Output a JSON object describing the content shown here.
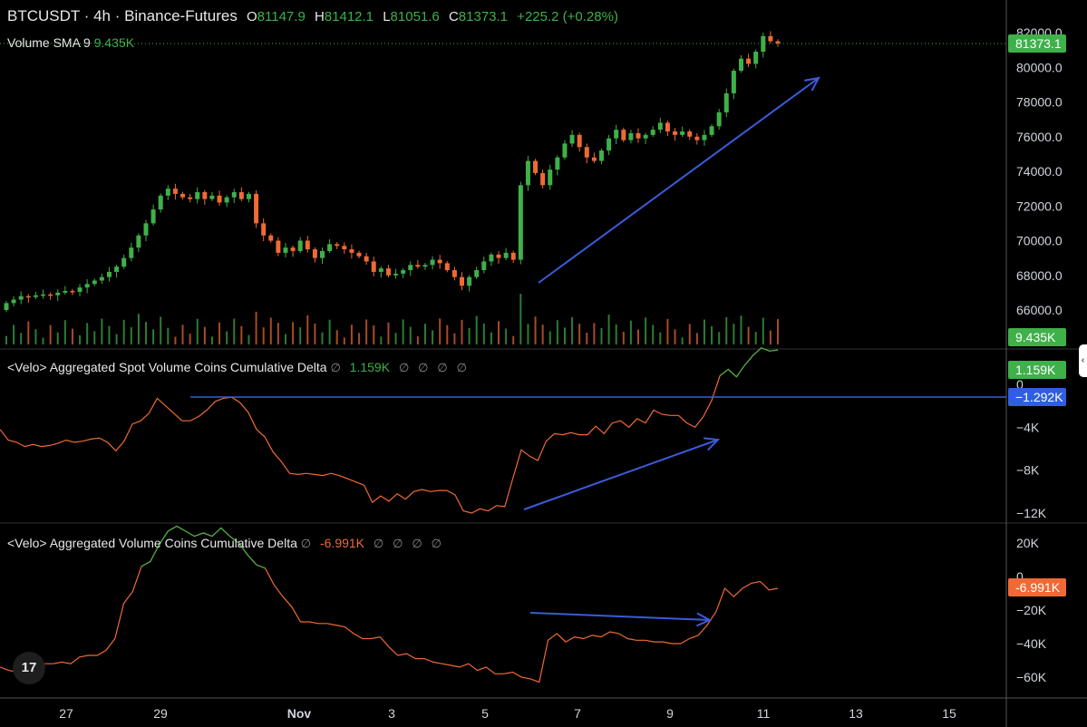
{
  "header": {
    "symbol": "BTCUSDT · 4h · Binance-Futures",
    "open_label": "O",
    "open": "81147.9",
    "high_label": "H",
    "high": "81412.1",
    "low_label": "L",
    "low": "81051.6",
    "close_label": "C",
    "close": "81373.1",
    "change": "+225.2 (+0.28%)",
    "volume_label": "Volume SMA 9",
    "volume_value": "9.435K"
  },
  "panes": {
    "spot": {
      "title": "<Velo> Aggregated Spot Volume Coins Cumulative Delta",
      "value": "1.159K",
      "icons": [
        "∅",
        "∅",
        "∅",
        "∅",
        "∅"
      ]
    },
    "agg": {
      "title": "<Velo> Aggregated Volume Coins Cumulative Delta",
      "value": "-6.991K",
      "icons": [
        "∅",
        "∅",
        "∅",
        "∅",
        "∅"
      ]
    }
  },
  "colors": {
    "up": "#3fb04a",
    "down": "#ef6a35",
    "line_pos": "#3fb04a",
    "line_neg": "#ef6a35",
    "annotation": "#3b5bdb",
    "grid": "#2a2a2a",
    "label_green": "#3fb04a",
    "label_blue": "#2f5fe0",
    "label_orange": "#ef6a35"
  },
  "logo": {
    "text": "17",
    "icon": "tradingview-logo-icon"
  },
  "chart_data": [
    {
      "type": "candlestick",
      "title": "BTCUSDT · 4h · Binance-Futures",
      "x_ticks": [
        "27",
        "29",
        "Nov",
        "3",
        "5",
        "7",
        "9",
        "11",
        "13",
        "15"
      ],
      "y_ticks": [
        "82000.0",
        "80000.0",
        "78000.0",
        "76000.0",
        "74000.0",
        "72000.0",
        "70000.0",
        "68000.0",
        "66000.0"
      ],
      "ylim": [
        65000,
        82400
      ],
      "last_price_label": "81373.1",
      "volume_label": "9.435K",
      "closes": [
        66400,
        66600,
        66800,
        66750,
        66850,
        66900,
        66850,
        67000,
        67100,
        67050,
        67300,
        67500,
        67700,
        67900,
        68200,
        68500,
        69000,
        69600,
        70300,
        71000,
        71800,
        72600,
        73000,
        72700,
        72500,
        72400,
        72800,
        72400,
        72600,
        72200,
        72500,
        72800,
        72400,
        72700,
        71000,
        70300,
        70000,
        69300,
        69600,
        69400,
        70000,
        69500,
        69000,
        69400,
        69800,
        69700,
        69500,
        69300,
        69100,
        68800,
        68200,
        68400,
        68000,
        68100,
        68300,
        68600,
        68500,
        68600,
        68900,
        68700,
        68300,
        67900,
        67400,
        67900,
        68300,
        68800,
        69200,
        69000,
        69300,
        68900,
        73200,
        74600,
        73900,
        73200,
        74100,
        74800,
        75600,
        76100,
        75400,
        74800,
        74600,
        75200,
        75900,
        76400,
        75800,
        76200,
        75900,
        76100,
        76400,
        76800,
        76300,
        76100,
        76300,
        76000,
        75800,
        76100,
        76600,
        77400,
        78500,
        79800,
        80500,
        80200,
        80900,
        81800,
        81500,
        81373
      ]
    },
    {
      "type": "line",
      "title": "<Velo> Aggregated Spot Volume Coins Cumulative Delta",
      "last_value": "1.159K",
      "y_ticks": [
        "0",
        "−4K",
        "−8K",
        "−12K"
      ],
      "ylim": [
        -12500,
        1800
      ],
      "marker_label": "−1.292K",
      "values": [
        -4200,
        -5200,
        -5400,
        -5800,
        -5600,
        -5800,
        -5700,
        -5500,
        -5200,
        -5400,
        -5300,
        -5100,
        -5000,
        -5400,
        -6200,
        -5300,
        -3700,
        -3400,
        -2700,
        -1300,
        -2000,
        -2700,
        -3400,
        -3400,
        -3000,
        -2400,
        -1600,
        -1300,
        -1200,
        -1700,
        -2600,
        -4200,
        -4900,
        -6300,
        -7200,
        -8300,
        -8400,
        -8300,
        -8400,
        -8500,
        -8300,
        -8500,
        -8800,
        -9100,
        -9400,
        -11000,
        -10400,
        -10900,
        -10200,
        -10700,
        -10000,
        -9800,
        -10000,
        -9900,
        -9900,
        -10300,
        -11800,
        -12000,
        -11600,
        -11800,
        -11300,
        -11400,
        -8700,
        -6100,
        -6700,
        -7100,
        -5300,
        -4600,
        -4700,
        -4500,
        -4700,
        -4700,
        -3900,
        -4600,
        -3600,
        -3400,
        -4000,
        -3200,
        -3600,
        -2400,
        -2800,
        -2900,
        -2900,
        -3600,
        -4000,
        -3000,
        -1500,
        800,
        1400,
        700,
        1800,
        2700,
        3400,
        3100,
        3200
      ]
    },
    {
      "type": "line",
      "title": "<Velo> Aggregated Volume Coins Cumulative Delta",
      "last_value": "-6.991K",
      "y_ticks": [
        "20K",
        "0",
        "−20K",
        "−40K",
        "−60K"
      ],
      "ylim": [
        -63000,
        22000
      ],
      "values": [
        -54000,
        -56000,
        -57000,
        -55000,
        -54000,
        -52000,
        -52000,
        -51000,
        -52000,
        -48000,
        -47000,
        -47000,
        -44000,
        -37000,
        -16000,
        -9000,
        6000,
        9000,
        19000,
        27000,
        30000,
        27000,
        24000,
        26000,
        24000,
        29000,
        24000,
        20000,
        13000,
        7000,
        5000,
        -5000,
        -12000,
        -18000,
        -27000,
        -27000,
        -28000,
        -28000,
        -29000,
        -30000,
        -34000,
        -37000,
        -37000,
        -36000,
        -42000,
        -47000,
        -46000,
        -49000,
        -49000,
        -51000,
        -52000,
        -53000,
        -54000,
        -52000,
        -56000,
        -54000,
        -58000,
        -58000,
        -57000,
        -60000,
        -61000,
        -63000,
        -38000,
        -34000,
        -39000,
        -36000,
        -37000,
        -35000,
        -36000,
        -33000,
        -34000,
        -37000,
        -38000,
        -38000,
        -39000,
        -39000,
        -40000,
        -40000,
        -37000,
        -35000,
        -29000,
        -21000,
        -7000,
        -12000,
        -7000,
        -4000,
        -3000,
        -8000,
        -7000
      ]
    }
  ],
  "annotations": {
    "up_arrows": 3,
    "flat_arrow": 1
  }
}
